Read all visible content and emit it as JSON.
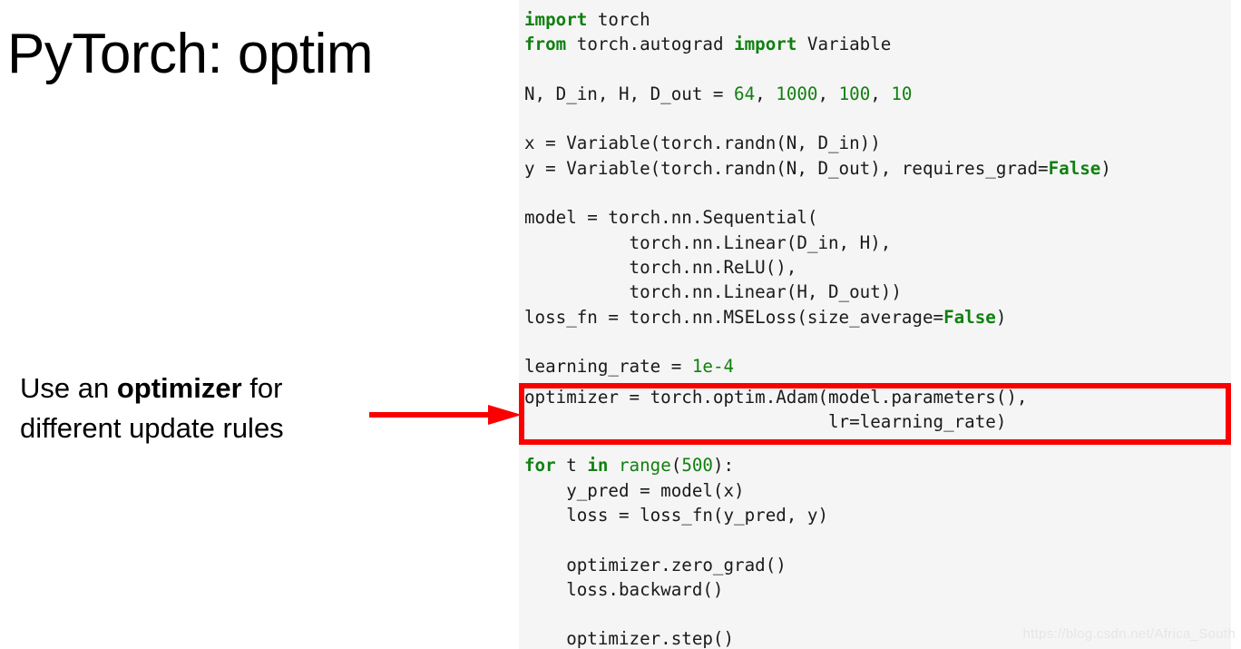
{
  "slide": {
    "title": "PyTorch: optim",
    "caption": {
      "before": "Use an ",
      "emphasis": "optimizer",
      "after": " for different update rules"
    }
  },
  "annotation": {
    "arrow_color": "#fb0000",
    "highlight_box_color": "#fb0000"
  },
  "code_panel": {
    "background": "#f5f5f5",
    "keyword_color": "#108010",
    "text_color": "#1a1a1a",
    "lines": [
      "import torch",
      "from torch.autograd import Variable",
      "",
      "N, D_in, H, D_out = 64, 1000, 100, 10",
      "",
      "x = Variable(torch.randn(N, D_in))",
      "y = Variable(torch.randn(N, D_out), requires_grad=False)",
      "",
      "model = torch.nn.Sequential(",
      "          torch.nn.Linear(D_in, H),",
      "          torch.nn.ReLU(),",
      "          torch.nn.Linear(H, D_out))",
      "loss_fn = torch.nn.MSELoss(size_average=False)",
      "",
      "learning_rate = 1e-4",
      "optimizer = torch.optim.Adam(model.parameters(),",
      "                             lr=learning_rate)",
      "",
      "for t in range(500):",
      "    y_pred = model(x)",
      "    loss = loss_fn(y_pred, y)",
      "",
      "    optimizer.zero_grad()",
      "    loss.backward()",
      "",
      "    optimizer.step()"
    ]
  },
  "highlight": {
    "lines": [
      "optimizer = torch.optim.Adam(model.parameters(),",
      "                             lr=learning_rate)"
    ]
  },
  "watermark": {
    "text": "https://blog.csdn.net/Africa_South"
  }
}
